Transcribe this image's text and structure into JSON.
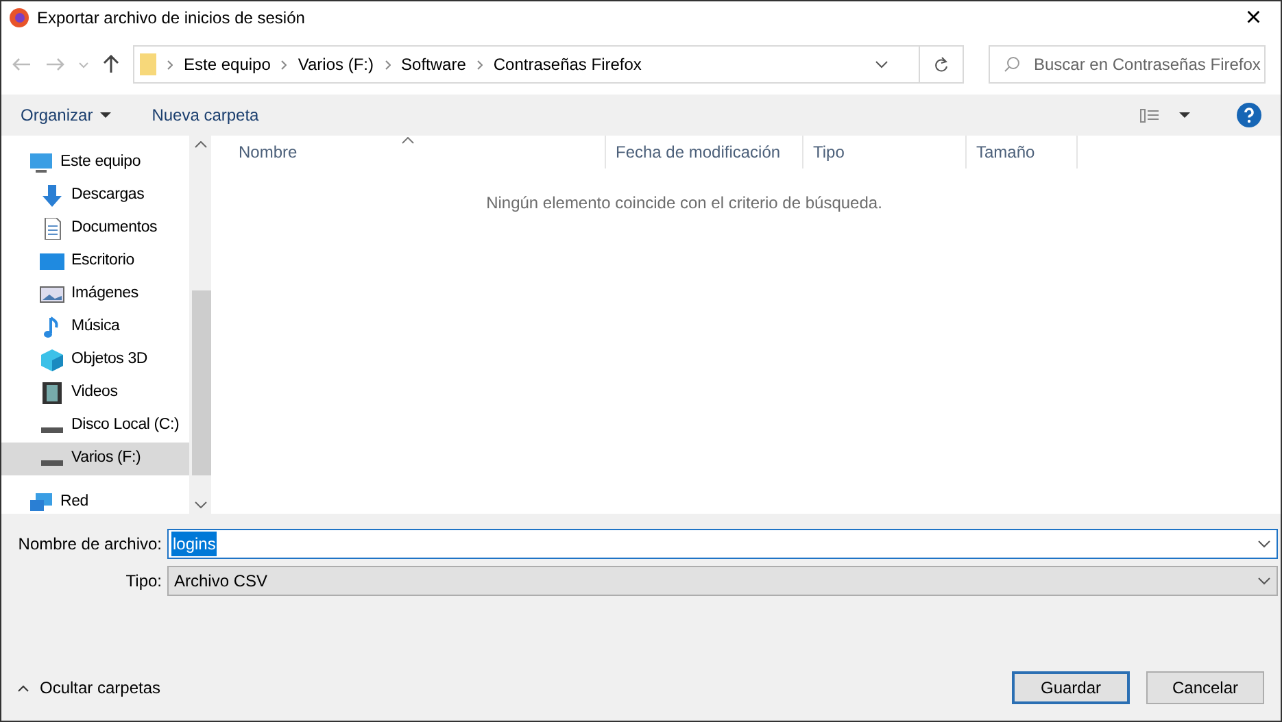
{
  "window": {
    "title": "Exportar archivo de inicios de sesión",
    "close": "×"
  },
  "address": {
    "crumbs": [
      "Este equipo",
      "Varios (F:)",
      "Software",
      "Contraseñas Firefox"
    ]
  },
  "search": {
    "placeholder": "Buscar en Contraseñas Firefox"
  },
  "toolbar": {
    "organize": "Organizar",
    "new_folder": "Nueva carpeta"
  },
  "sidebar": {
    "items": [
      {
        "label": "Este equipo",
        "kind": "computer",
        "selected": false,
        "children": [
          {
            "label": "Descargas",
            "kind": "download",
            "selected": false
          },
          {
            "label": "Documentos",
            "kind": "document",
            "selected": false
          },
          {
            "label": "Escritorio",
            "kind": "desktop",
            "selected": false
          },
          {
            "label": "Imágenes",
            "kind": "image",
            "selected": false
          },
          {
            "label": "Música",
            "kind": "music",
            "selected": false
          },
          {
            "label": "Objetos 3D",
            "kind": "cube",
            "selected": false
          },
          {
            "label": "Videos",
            "kind": "film",
            "selected": false
          },
          {
            "label": "Disco Local (C:)",
            "kind": "drive",
            "selected": false
          },
          {
            "label": "Varios (F:)",
            "kind": "drive",
            "selected": true
          }
        ]
      },
      {
        "label": "Red",
        "kind": "network",
        "selected": false
      }
    ]
  },
  "table": {
    "columns": [
      "Nombre",
      "Fecha de modificación",
      "Tipo",
      "Tamaño"
    ],
    "empty_message": "Ningún elemento coincide con el criterio de búsqueda."
  },
  "form": {
    "filename_label": "Nombre de archivo:",
    "filename": "logins",
    "type_label": "Tipo:",
    "type": "Archivo CSV"
  },
  "footer": {
    "hide_folders": "Ocultar carpetas",
    "buttons": [
      {
        "label": "Guardar",
        "default": true
      },
      {
        "label": "Cancelar",
        "default": false
      }
    ]
  }
}
